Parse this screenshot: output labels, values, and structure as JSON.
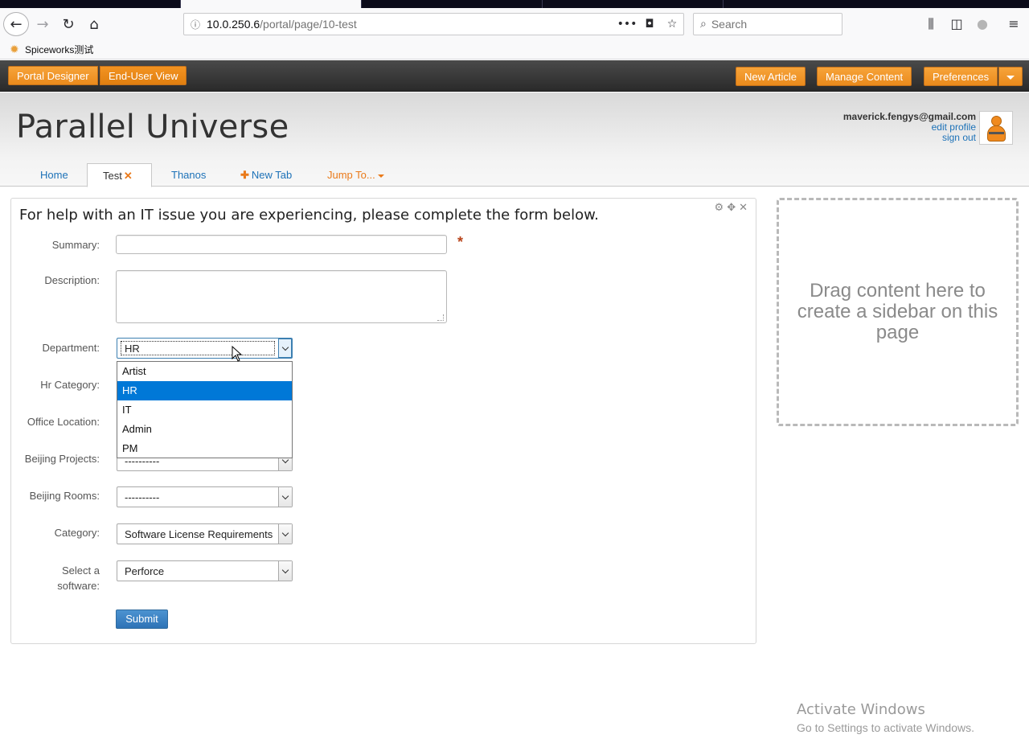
{
  "browser": {
    "url_host": "10.0.250.6",
    "url_path": "/portal/page/10-test",
    "search_placeholder": "Search",
    "bookmark_label": "Spiceworks测试"
  },
  "admin_bar": {
    "portal_designer": "Portal Designer",
    "end_user_view": "End-User View",
    "new_article": "New Article",
    "manage_content": "Manage Content",
    "preferences": "Preferences"
  },
  "header": {
    "site_title": "Parallel Universe",
    "user_email": "maverick.fengys@gmail.com",
    "edit_profile": "edit profile",
    "sign_out": "sign out"
  },
  "tabs": {
    "home": "Home",
    "test": "Test",
    "thanos": "Thanos",
    "new_tab": "New Tab",
    "jump_to": "Jump To..."
  },
  "form": {
    "heading": "For help with an IT issue you are experiencing, please complete the form below.",
    "labels": {
      "summary": "Summary:",
      "description": "Description:",
      "department": "Department:",
      "hr_category": "Hr Category:",
      "office_location": "Office Location:",
      "beijing_projects": "Beijing Projects:",
      "beijing_rooms": "Beijing Rooms:",
      "category": "Category:",
      "select_software_1": "Select a",
      "select_software_2": "software:"
    },
    "required_mark": "*",
    "values": {
      "department": "HR",
      "beijing_projects": "----------",
      "beijing_rooms": "----------",
      "category": "Software License Requirements",
      "software": "Perforce"
    },
    "department_options": [
      "Artist",
      "HR",
      "IT",
      "Admin",
      "PM"
    ],
    "department_selected_index": 1,
    "submit": "Submit"
  },
  "sidebar_drop": "Drag content here to create a sidebar on this page",
  "watermark": {
    "line1": "Activate Windows",
    "line2": "Go to Settings to activate Windows."
  },
  "colors": {
    "accent_orange": "#ea8a1c",
    "link_blue": "#1d72b8",
    "submit_blue": "#2e73b6",
    "selected_option": "#0078d7"
  }
}
